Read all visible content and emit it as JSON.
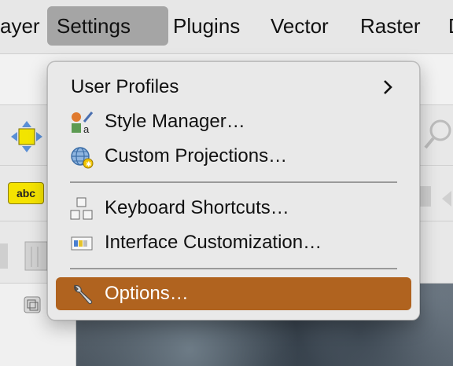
{
  "menubar": {
    "items": [
      {
        "label": "ayer"
      },
      {
        "label": "Settings"
      },
      {
        "label": "Plugins"
      },
      {
        "label": "Vector"
      },
      {
        "label": "Raster"
      },
      {
        "label": "D"
      }
    ],
    "active_item": "Settings"
  },
  "settings_menu": {
    "items": [
      {
        "label": "User Profiles",
        "icon": "none",
        "has_submenu": true
      },
      {
        "label": "Style Manager…",
        "icon": "style-manager-icon"
      },
      {
        "label": "Custom Projections…",
        "icon": "globe-projection-icon"
      },
      {
        "label": "Keyboard Shortcuts…",
        "icon": "keyboard-shortcuts-icon"
      },
      {
        "label": "Interface Customization…",
        "icon": "interface-customization-icon"
      },
      {
        "label": "Options…",
        "icon": "wrench-icon",
        "selected": true
      }
    ]
  },
  "toolbar": {
    "label_tool_text": "abc"
  },
  "colors": {
    "menu_highlight": "#b0631f",
    "menubar_active": "#a5a5a5",
    "menu_bg": "#e9e9e9"
  }
}
